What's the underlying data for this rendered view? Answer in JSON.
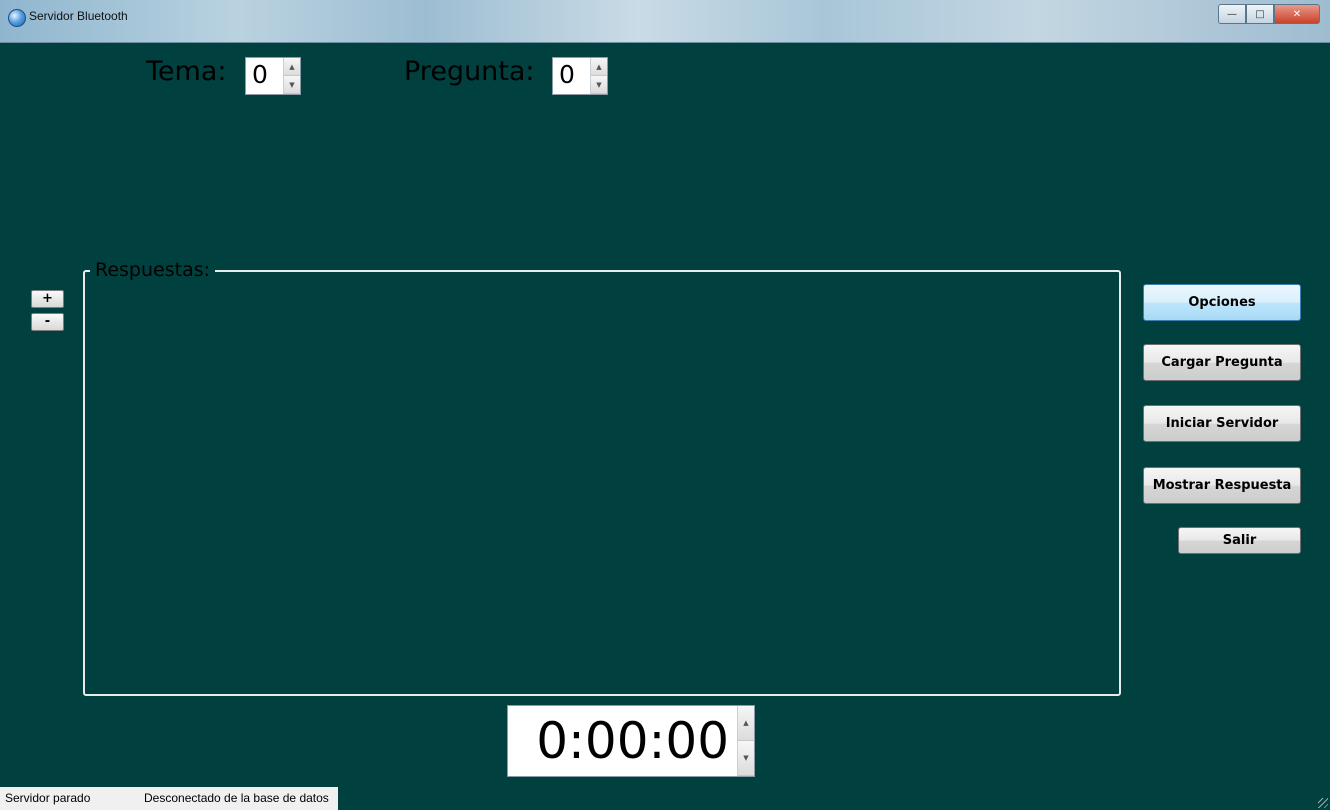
{
  "window": {
    "title": "Servidor Bluetooth",
    "icon": "bluetooth-icon",
    "controls": {
      "minimize": "minimize-icon",
      "maximize": "maximize-icon",
      "close": "close-icon"
    },
    "background_color": "#00403f"
  },
  "header": {
    "tema_label": "Tema:",
    "tema_value": "0",
    "pregunta_label": "Pregunta:",
    "pregunta_value": "0"
  },
  "answers": {
    "legend": "Respuestas:",
    "add_label": "+",
    "remove_label": "-"
  },
  "buttons": {
    "opciones": "Opciones",
    "cargar_pregunta": "Cargar Pregunta",
    "iniciar_servidor": "Iniciar Servidor",
    "mostrar_respuesta": "Mostrar Respuesta",
    "salir": "Salir"
  },
  "timer": {
    "value": "0:00:00"
  },
  "status": {
    "server": "Servidor parado",
    "database": "Desconectado de la base de datos"
  }
}
